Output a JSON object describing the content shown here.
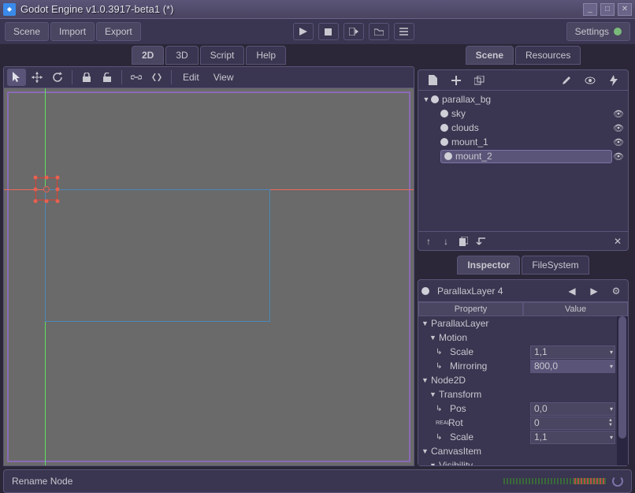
{
  "window": {
    "title": "Godot Engine v1.0.3917-beta1 (*)"
  },
  "main_menu": {
    "scene": "Scene",
    "import": "Import",
    "export": "Export",
    "settings": "Settings"
  },
  "viewport_tabs": {
    "_2d": "2D",
    "_3d": "3D",
    "script": "Script",
    "help": "Help"
  },
  "viewport_menu": {
    "edit": "Edit",
    "view": "View"
  },
  "scene_panel": {
    "tab_scene": "Scene",
    "tab_resources": "Resources",
    "nodes": {
      "root": "parallax_bg",
      "children": [
        {
          "name": "sky",
          "color": "#cfcfd8"
        },
        {
          "name": "clouds",
          "color": "#cfcfd8"
        },
        {
          "name": "mount_1",
          "color": "#cfcfd8"
        },
        {
          "name": "mount_2",
          "color": "#cfcfd8"
        }
      ]
    }
  },
  "inspector": {
    "tab_inspector": "Inspector",
    "tab_filesystem": "FileSystem",
    "node_type": "ParallaxLayer 4",
    "col_property": "Property",
    "col_value": "Value",
    "sections": {
      "parallax_layer": "ParallaxLayer",
      "motion": "Motion",
      "node2d": "Node2D",
      "transform": "Transform",
      "canvas_item": "CanvasItem",
      "visibility": "Visibility"
    },
    "props": {
      "scale": {
        "label": "Scale",
        "value": "1,1"
      },
      "mirroring": {
        "label": "Mirroring",
        "value": "800,0"
      },
      "pos": {
        "label": "Pos",
        "value": "0,0"
      },
      "rot": {
        "label": "Rot",
        "value": "0",
        "kind": "REAL"
      },
      "scale2": {
        "label": "Scale",
        "value": "1,1"
      }
    }
  },
  "status": {
    "text": "Rename Node"
  }
}
